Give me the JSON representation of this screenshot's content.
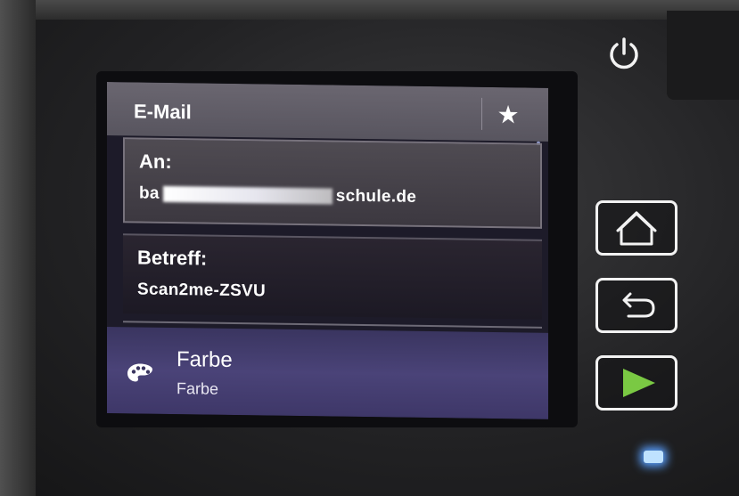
{
  "screen": {
    "title": "E-Mail",
    "title_icon": "star-icon",
    "to_field": {
      "label": "An:",
      "value_prefix": "ba",
      "value_suffix": "schule.de"
    },
    "subject_field": {
      "label": "Betreff:",
      "value": "Scan2me-ZSVU"
    },
    "color_option": {
      "icon": "palette-icon",
      "title": "Farbe",
      "value": "Farbe"
    }
  },
  "hardware_buttons": {
    "power": "power-icon",
    "home": "home-icon",
    "back": "back-icon",
    "start": "start-icon"
  },
  "colors": {
    "start_green": "#7ac943",
    "led_blue": "#5aa0ff"
  }
}
